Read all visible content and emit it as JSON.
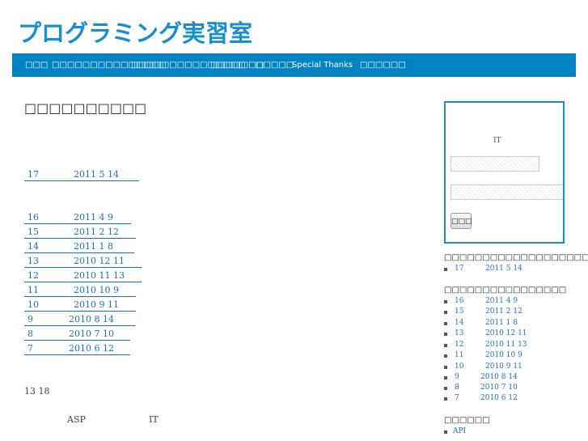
{
  "header": {
    "logo_text": "プログラミング実習室"
  },
  "nav": {
    "items": [
      {
        "label": "□□□"
      },
      {
        "label": "□□□□□□□□□□□□□□□"
      },
      {
        "label": "□□□□□□□□□□□□□□□"
      },
      {
        "label": "□□□□□□□"
      },
      {
        "label": "□□□□□"
      },
      {
        "label": "Special Thanks"
      },
      {
        "label": "□□□□□□"
      }
    ]
  },
  "main": {
    "page_title": "□□□□□□□□□□",
    "latest_post": {
      "num": "17",
      "date": "2011 5 14"
    },
    "past_posts": [
      {
        "num": "16",
        "date": "2011 4 9"
      },
      {
        "num": "15",
        "date": "2011 2 12"
      },
      {
        "num": "14",
        "date": "2011 1 8"
      },
      {
        "num": "13",
        "date": "2010 12 11"
      },
      {
        "num": "12",
        "date": "2010 11 13"
      },
      {
        "num": "11",
        "date": "2010 10 9"
      },
      {
        "num": "10",
        "date": "2010 9 11"
      },
      {
        "num": "9",
        "date": "2010 8 14"
      },
      {
        "num": "8",
        "date": "2010 7 10"
      },
      {
        "num": "7",
        "date": "2010 6 12"
      }
    ],
    "text_line1": "13 18",
    "text_line2_a": "ASP",
    "text_line2_b": "IT"
  },
  "sidebar": {
    "login": {
      "note": "IT",
      "username_value": "",
      "password_value": "",
      "button_label": "□□□"
    },
    "section1_title": "□□□□□□□□□□□□□□□□□□□□",
    "section1_items": [
      {
        "num": "17",
        "date": "2011 5 14"
      }
    ],
    "section2_title": "□□□□□□□□□□□□□□□□",
    "section2_items": [
      {
        "num": "16",
        "date": "2011 4 9"
      },
      {
        "num": "15",
        "date": "2011 2 12"
      },
      {
        "num": "14",
        "date": "2011 1 8"
      },
      {
        "num": "13",
        "date": "2010 12 11"
      },
      {
        "num": "12",
        "date": "2010 11 13"
      },
      {
        "num": "11",
        "date": "2010 10 9"
      },
      {
        "num": "10",
        "date": "2010 9 11"
      },
      {
        "num": "9",
        "date": "2010 8 14"
      },
      {
        "num": "8",
        "date": "2010 7 10"
      },
      {
        "num": "7",
        "date": "2010 6 12"
      }
    ],
    "section3_title": "□□□□□□",
    "section3_items": [
      {
        "label": "API"
      }
    ]
  },
  "colors": {
    "accent": "#0083c3",
    "logo": "#1a8fd0",
    "link": "#1f6fbf"
  }
}
